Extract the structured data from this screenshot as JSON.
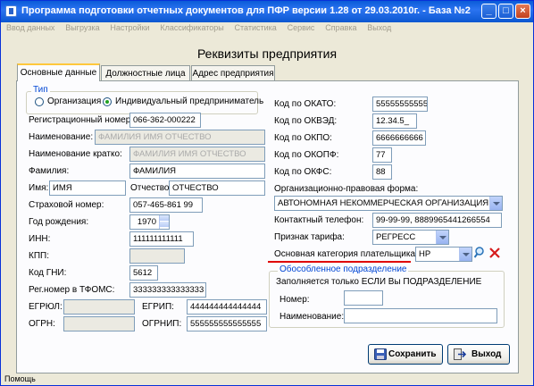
{
  "window": {
    "title": "Программа подготовки отчетных документов для ПФР версии 1.28 от 29.03.2010г. - База №2"
  },
  "menu": [
    "Ввод данных",
    "Выгрузка",
    "Настройки",
    "Классификаторы",
    "Статистика",
    "Сервис",
    "Справка",
    "Выход"
  ],
  "heading": "Реквизиты предприятия",
  "tabs": [
    "Основные данные",
    "Должностные лица",
    "Адрес предприятия"
  ],
  "type_group": {
    "label": "Тип",
    "org": "Организация",
    "ip": "Индивидуальный предприниматель",
    "selected": "ip"
  },
  "left": {
    "reg_no": {
      "label": "Регистрационный номер:",
      "value": "066-362-000222"
    },
    "name": {
      "label": "Наименование:",
      "value": "ФАМИЛИЯ ИМЯ ОТЧЕСТВО"
    },
    "short_name": {
      "label": "Наименование кратко:",
      "value": "ФАМИЛИЯ ИМЯ ОТЧЕСТВО"
    },
    "surname": {
      "label": "Фамилия:",
      "value": "ФАМИЛИЯ"
    },
    "first_name": {
      "label": "Имя:",
      "value": "ИМЯ"
    },
    "patronymic": {
      "label": "Отчество:",
      "value": "ОТЧЕСТВО"
    },
    "insurance_no": {
      "label": "Страховой номер:",
      "value": "057-465-861 99"
    },
    "birth_year": {
      "label": "Год рождения:",
      "value": "1970"
    },
    "inn": {
      "label": "ИНН:",
      "value": "111111111111"
    },
    "kpp": {
      "label": "КПП:",
      "value": ""
    },
    "gni": {
      "label": "Код ГНИ:",
      "value": "5612"
    },
    "tfoms": {
      "label": "Рег.номер в ТФОМС:",
      "value": "333333333333333"
    },
    "egrul": {
      "label": "ЕГРЮЛ:",
      "value": ""
    },
    "egrip": {
      "label": "ЕГРИП:",
      "value": "444444444444444"
    },
    "ogrn": {
      "label": "ОГРН:",
      "value": ""
    },
    "ogrnip": {
      "label": "ОГРНИП:",
      "value": "555555555555555"
    }
  },
  "right": {
    "okato": {
      "label": "Код по ОКАТО:",
      "value": "55555555555"
    },
    "okved": {
      "label": "Код по ОКВЭД:",
      "value": "12.34.5_"
    },
    "okpo": {
      "label": "Код по ОКПО:",
      "value": "6666666666"
    },
    "okopf": {
      "label": "Код по ОКОПФ:",
      "value": "77"
    },
    "okfs": {
      "label": "Код по ОКФС:",
      "value": "88"
    },
    "legal_form": {
      "label": "Организационно-правовая форма:",
      "value": "АВТОНОМНАЯ НЕКОММЕРЧЕСКАЯ ОРГАНИЗАЦИЯ"
    },
    "phone": {
      "label": "Контактный телефон:",
      "value": "99-99-99, 8889965441266554"
    },
    "tariff": {
      "label": "Признак тарифа:",
      "value": "РЕГРЕСС"
    },
    "payer_cat": {
      "label": "Основная категория плательщика:",
      "value": "НР"
    }
  },
  "subdivision": {
    "label": "Обособленное подразделение",
    "note": "Заполняется только ЕСЛИ Вы ПОДРАЗДЕЛЕНИЕ",
    "number_label": "Номер:",
    "number_value": "",
    "name_label": "Наименование:",
    "name_value": ""
  },
  "buttons": {
    "save": "Сохранить",
    "exit": "Выход"
  },
  "status": "Помощь",
  "colors": {
    "accent_underline": "#e00000",
    "titlebar": "#0a5bd8",
    "groupbox_label": "#0046d5"
  }
}
